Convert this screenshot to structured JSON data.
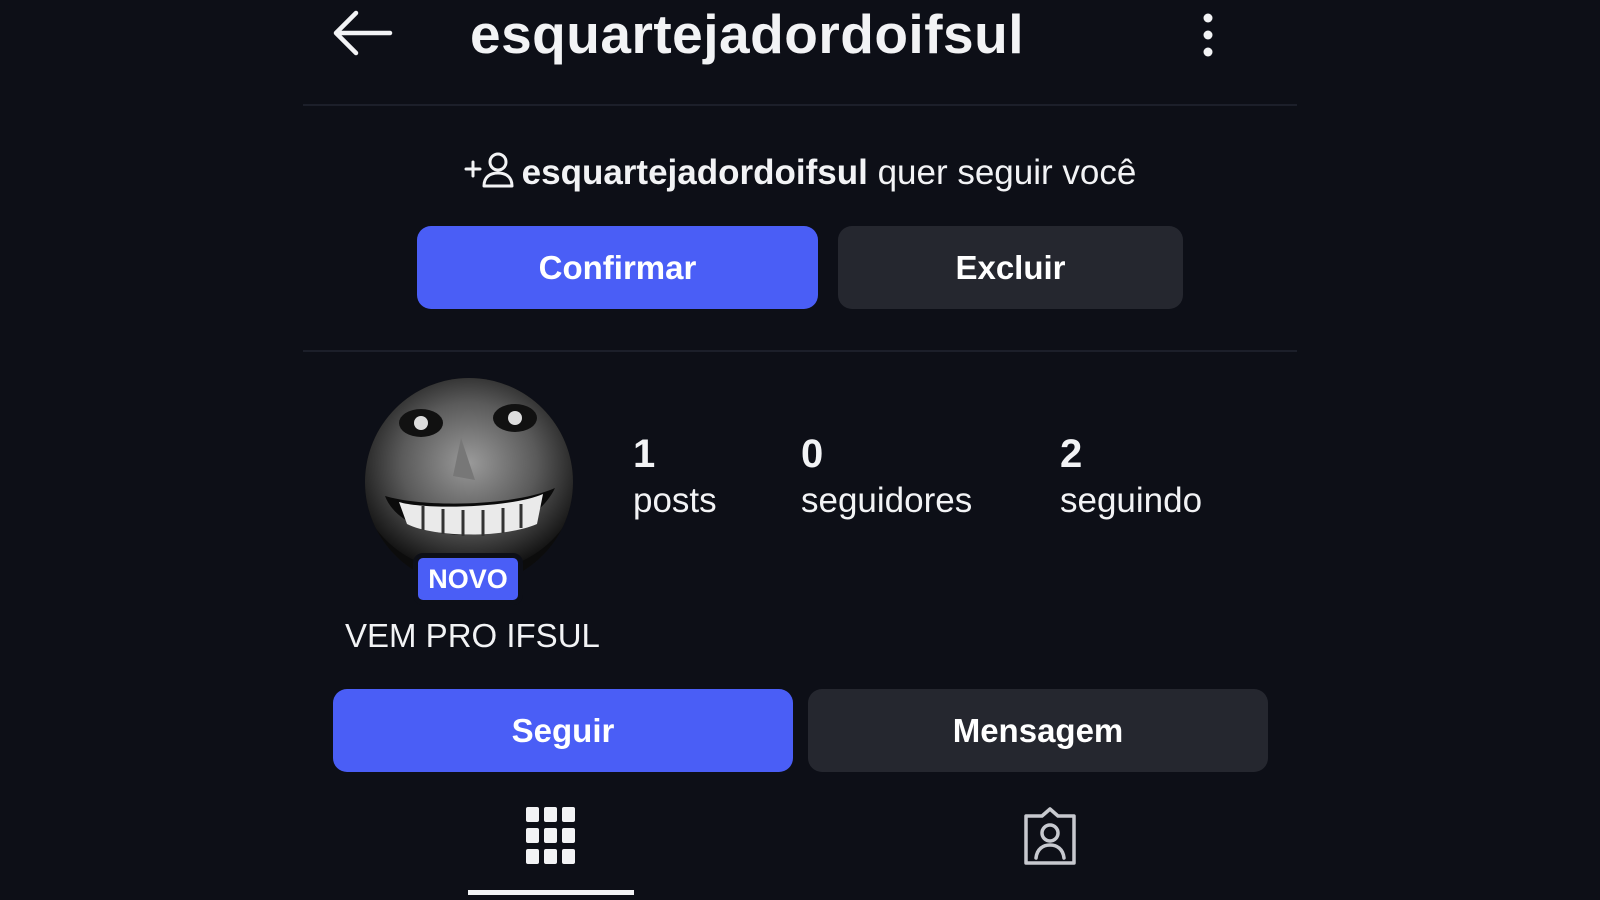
{
  "header": {
    "title": "esquartejadordoifsul",
    "back_icon": "arrow-left-icon",
    "more_icon": "more-vertical-icon"
  },
  "follow_request": {
    "icon": "add-person-icon",
    "username": "esquartejadordoifsul",
    "message": "quer seguir você",
    "confirm_label": "Confirmar",
    "delete_label": "Excluir"
  },
  "profile": {
    "avatar_icon": "profile-photo",
    "badge": "NOVO",
    "stats": [
      {
        "value": "1",
        "label": "posts"
      },
      {
        "value": "0",
        "label": "seguidores"
      },
      {
        "value": "2",
        "label": "seguindo"
      }
    ],
    "bio": "VEM PRO IFSUL",
    "follow_label": "Seguir",
    "message_label": "Mensagem"
  },
  "tabs": [
    {
      "icon": "grid-icon",
      "active": true
    },
    {
      "icon": "tagged-person-icon",
      "active": false
    }
  ],
  "colors": {
    "background": "#0d0f17",
    "accent": "#4a5ef6",
    "secondary_button": "#25272f",
    "text": "#f2f3f5"
  }
}
